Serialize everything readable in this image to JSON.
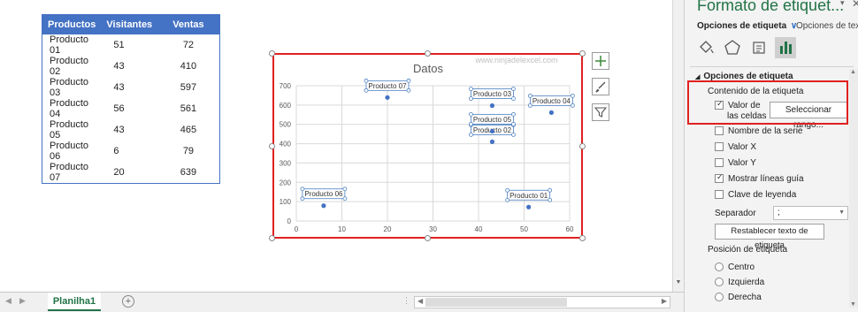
{
  "table": {
    "headers": [
      "Productos",
      "Visitantes",
      "Ventas"
    ],
    "rows": [
      [
        "Producto 01",
        "51",
        "72"
      ],
      [
        "Producto 02",
        "43",
        "410"
      ],
      [
        "Producto 03",
        "43",
        "597"
      ],
      [
        "Producto 04",
        "56",
        "561"
      ],
      [
        "Producto 05",
        "43",
        "465"
      ],
      [
        "Producto 06",
        "6",
        "79"
      ],
      [
        "Producto 07",
        "20",
        "639"
      ]
    ]
  },
  "chart_data": {
    "type": "scatter",
    "title": "Datos",
    "watermark": "www.ninjadelexcel.com",
    "xlim": [
      0,
      60
    ],
    "ylim": [
      0,
      700
    ],
    "xticks": [
      "0",
      "10",
      "20",
      "30",
      "40",
      "50",
      "60"
    ],
    "yticks": [
      "0",
      "100",
      "200",
      "300",
      "400",
      "500",
      "600",
      "700"
    ],
    "grid": true,
    "point_color": "#4472c4",
    "points": [
      {
        "label": "Producto 01",
        "x": 51,
        "y": 72
      },
      {
        "label": "Producto 02",
        "x": 43,
        "y": 410
      },
      {
        "label": "Producto 03",
        "x": 43,
        "y": 597
      },
      {
        "label": "Producto 04",
        "x": 56,
        "y": 561
      },
      {
        "label": "Producto 05",
        "x": 43,
        "y": 465
      },
      {
        "label": "Producto 06",
        "x": 6,
        "y": 79
      },
      {
        "label": "Producto 07",
        "x": 20,
        "y": 639
      }
    ]
  },
  "chart_buttons": [
    "plus-icon",
    "brush-icon",
    "filter-icon"
  ],
  "sheet_tab": "Planilha1",
  "pane": {
    "title": "Formato de etiquet...",
    "tab_active": "Opciones de etiqueta",
    "tab_other": "Opciones de texto",
    "section": "Opciones de etiqueta",
    "contenido": "Contenido de la etiqueta",
    "valor_de": "Valor de",
    "las_celdas": "las celdas",
    "seleccionar": "Seleccionar rango...",
    "nombre_serie": "Nombre de la serie",
    "valor_x": "Valor X",
    "valor_y": "Valor Y",
    "mostrar_lineas": "Mostrar líneas guía",
    "clave_leyenda": "Clave de leyenda",
    "separador": "Separador",
    "separador_value": ";",
    "restablecer": "Restablecer texto de etiqueta",
    "posicion": "Posición de etiqueta",
    "centro": "Centro",
    "izquierda": "Izquierda",
    "derecha": "Derecha"
  },
  "colors": {
    "accent": "#217346",
    "table_header": "#4472c4",
    "highlight": "#e02020"
  }
}
